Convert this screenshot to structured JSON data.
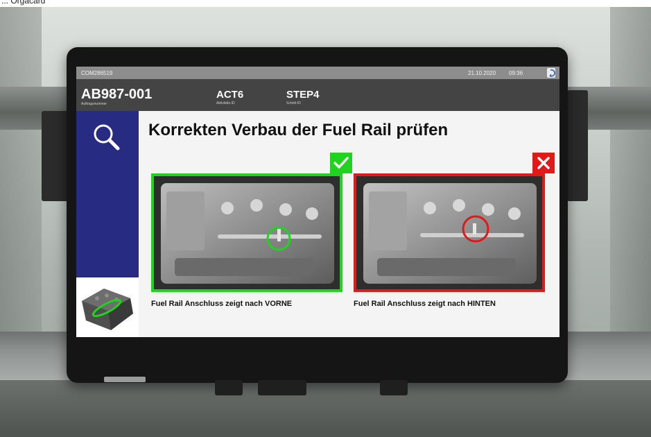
{
  "background": {
    "caption": "... Orgacard"
  },
  "statusbar": {
    "id": "COM286519",
    "date": "21.10.2020",
    "time": "09:36"
  },
  "header": {
    "order": {
      "value": "AB987-001",
      "caption": "Auftragsnummer"
    },
    "activity": {
      "value": "ACT6",
      "caption": "Aktivitäts-ID"
    },
    "step": {
      "value": "STEP4",
      "caption": "Schritt-ID"
    }
  },
  "sidebar": {
    "icon": "search-icon",
    "thumbnail": "engine-thumbnail"
  },
  "main": {
    "title": "Korrekten Verbau der Fuel Rail prüfen",
    "correct": {
      "status_icon": "check-icon",
      "caption": "Fuel Rail Anschluss zeigt nach VORNE"
    },
    "incorrect": {
      "status_icon": "close-icon",
      "caption": "Fuel Rail Anschluss zeigt nach HINTEN"
    }
  },
  "colors": {
    "ok": "#1fd31f",
    "nok": "#e01919",
    "sidebar": "#282b82",
    "header": "#444444",
    "statusbar": "#8d8d8d"
  }
}
